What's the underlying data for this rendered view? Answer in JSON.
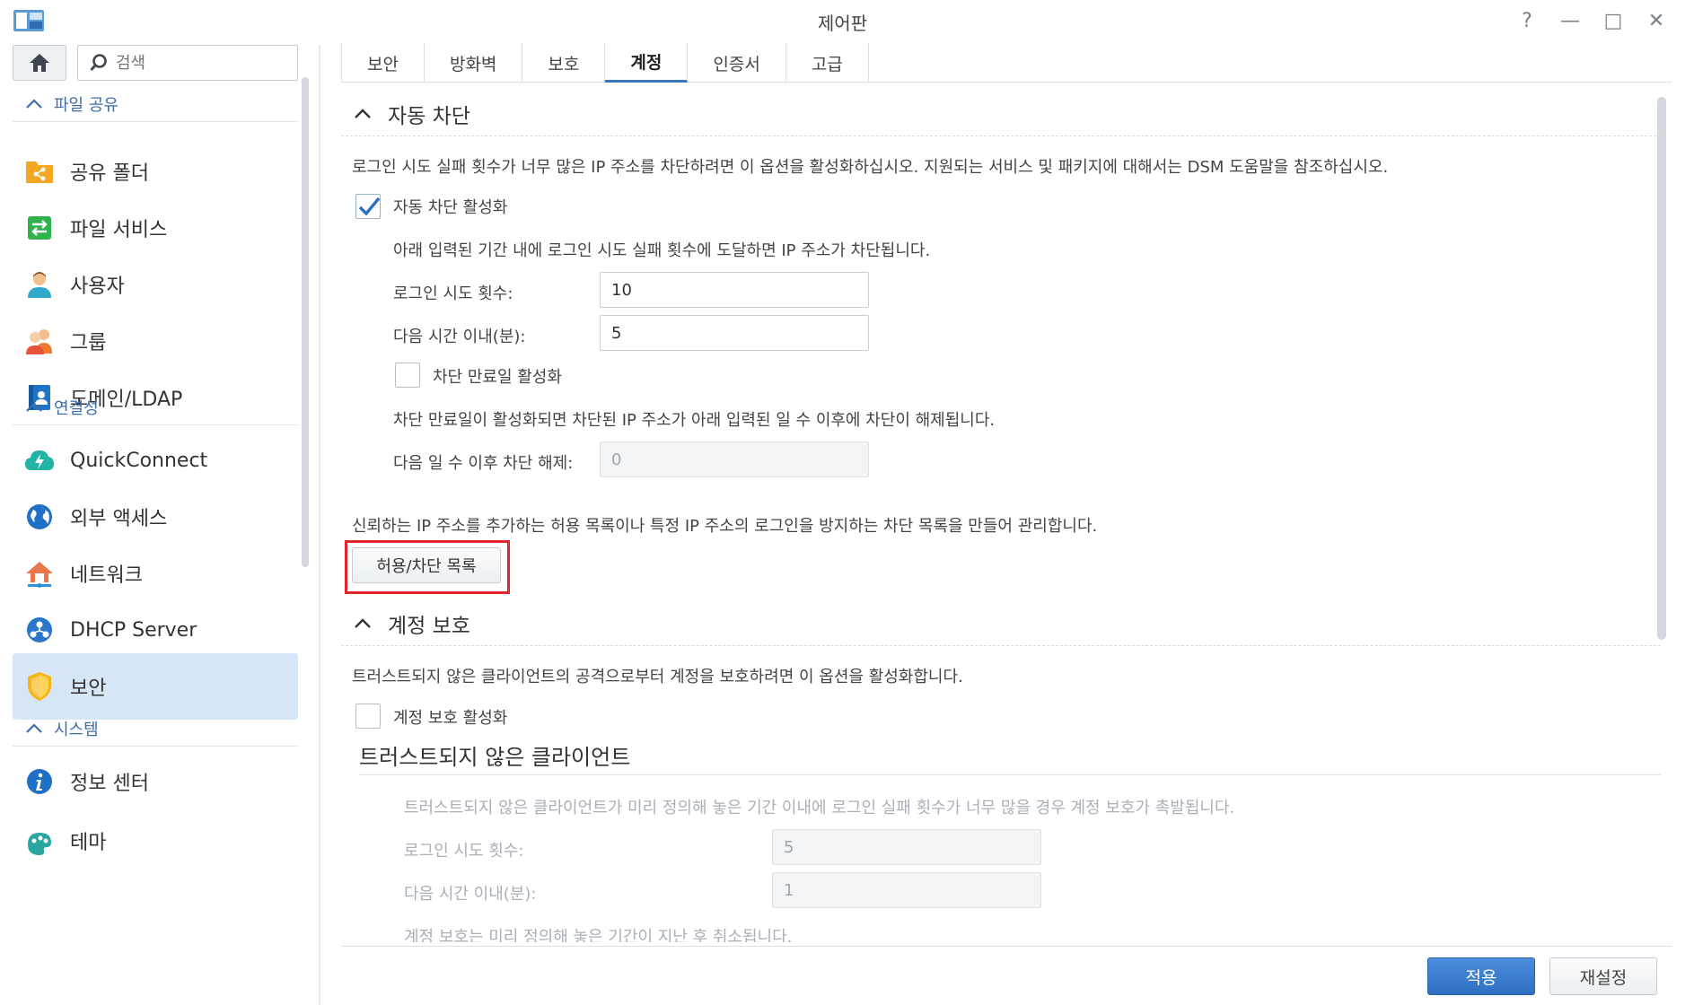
{
  "window": {
    "title": "제어판",
    "help_glyph": "?",
    "minimize_glyph": "—",
    "maximize_glyph": "□",
    "close_glyph": "✕"
  },
  "sidebar": {
    "search_placeholder": "검색",
    "sections": [
      {
        "label": "파일 공유"
      },
      {
        "label": "연결성"
      },
      {
        "label": "시스템"
      }
    ],
    "items": [
      {
        "label": "공유 폴더",
        "icon": "shared-folder-icon"
      },
      {
        "label": "파일 서비스",
        "icon": "file-services-icon"
      },
      {
        "label": "사용자",
        "icon": "user-icon"
      },
      {
        "label": "그룹",
        "icon": "group-icon"
      },
      {
        "label": "도메인/LDAP",
        "icon": "domain-ldap-icon"
      },
      {
        "label": "QuickConnect",
        "icon": "quickconnect-icon"
      },
      {
        "label": "외부 액세스",
        "icon": "external-access-icon"
      },
      {
        "label": "네트워크",
        "icon": "network-icon"
      },
      {
        "label": "DHCP Server",
        "icon": "dhcp-server-icon"
      },
      {
        "label": "보안",
        "icon": "security-shield-icon",
        "active": true
      },
      {
        "label": "정보 센터",
        "icon": "info-center-icon"
      },
      {
        "label": "테마",
        "icon": "theme-icon"
      }
    ]
  },
  "tabs": [
    {
      "label": "보안"
    },
    {
      "label": "방화벽"
    },
    {
      "label": "보호"
    },
    {
      "label": "계정",
      "active": true
    },
    {
      "label": "인증서"
    },
    {
      "label": "고급"
    }
  ],
  "auto_block": {
    "header": "자동 차단",
    "description": "로그인 시도 실패 횟수가 너무 많은 IP 주소를 차단하려면 이 옵션을 활성화하십시오. 지원되는 서비스 및 패키지에 대해서는 DSM 도움말을 참조하십시오.",
    "enable_label": "자동 차단 활성화",
    "enable_checked": true,
    "hint": "아래 입력된 기간 내에 로그인 시도 실패 횟수에 도달하면 IP 주소가 차단됩니다.",
    "attempts_label": "로그인 시도 횟수:",
    "attempts_value": "10",
    "within_label": "다음 시간 이내(분):",
    "within_value": "5",
    "expire_enable_label": "차단 만료일 활성화",
    "expire_checked": false,
    "expire_hint": "차단 만료일이 활성화되면 차단된 IP 주소가 아래 입력된 일 수 이후에 차단이 해제됩니다.",
    "unblock_label": "다음 일 수 이후 차단 해제:",
    "unblock_value": "0",
    "list_hint": "신뢰하는 IP 주소를 추가하는 허용 목록이나 특정 IP 주소의 로그인을 방지하는 차단 목록을 만들어 관리합니다.",
    "list_button": "허용/차단 목록"
  },
  "account_protection": {
    "header": "계정 보호",
    "description": "트러스트되지 않은 클라이언트의 공격으로부터 계정을 보호하려면 이 옵션을 활성화합니다.",
    "enable_label": "계정 보호 활성화",
    "enable_checked": false,
    "untrusted_heading": "트러스트되지 않은 클라이언트",
    "untrusted_hint": "트러스트되지 않은 클라이언트가 미리 정의해 놓은 기간 이내에 로그인 실패 횟수가 너무 많을 경우 계정 보호가 촉발됩니다.",
    "attempts_label": "로그인 시도 횟수:",
    "attempts_value": "5",
    "within_label": "다음 시간 이내(분):",
    "within_value": "1",
    "cancel_hint": "계정 보호는 미리 정의해 놓은 기간이 지난 후 취소됩니다."
  },
  "footer": {
    "apply": "적용",
    "reset": "재설정"
  },
  "colors": {
    "accent": "#3b77c9",
    "highlight": "#e4232d",
    "active_nav": "#d7e6f6"
  }
}
